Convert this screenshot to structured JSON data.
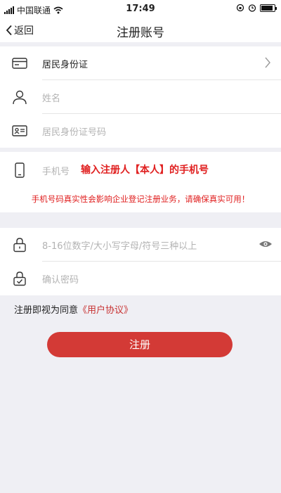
{
  "status_bar": {
    "carrier": "中国联通",
    "time": "17:49"
  },
  "nav": {
    "back_label": "返回",
    "title": "注册账号"
  },
  "identity_section": {
    "id_type": "居民身份证",
    "name_placeholder": "姓名",
    "id_number_placeholder": "居民身份证号码"
  },
  "phone_section": {
    "phone_placeholder": "手机号",
    "annotation": "输入注册人【本人】的手机号",
    "warning": "手机号码真实性会影响企业登记注册业务，请确保真实可用！"
  },
  "password_section": {
    "password_placeholder": "8-16位数字/大小写字母/符号三种以上",
    "confirm_placeholder": "确认密码"
  },
  "agreement": {
    "prefix": "注册即视为同意",
    "link": "《用户协议》"
  },
  "register_button": {
    "label": "注册"
  },
  "colors": {
    "accent": "#d33a36",
    "warning": "#e02020",
    "background": "#efeff4"
  }
}
